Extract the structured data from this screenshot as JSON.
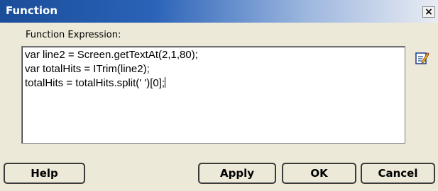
{
  "window": {
    "title": "Function",
    "close_label": "×"
  },
  "form": {
    "label": "Function Expression:",
    "lines": [
      "var line2 = Screen.getTextAt(2,1,80);",
      "var totalHits = ITrim(line2);",
      "totalHits = totalHits.split(' ')[0];"
    ],
    "editor_icon": "edit-pencil-icon"
  },
  "buttons": {
    "help": "Help",
    "apply": "Apply",
    "ok": "OK",
    "cancel": "Cancel"
  },
  "colors": {
    "dialog_bg": "#ece9d8",
    "title_bar": "#1a4d99"
  }
}
